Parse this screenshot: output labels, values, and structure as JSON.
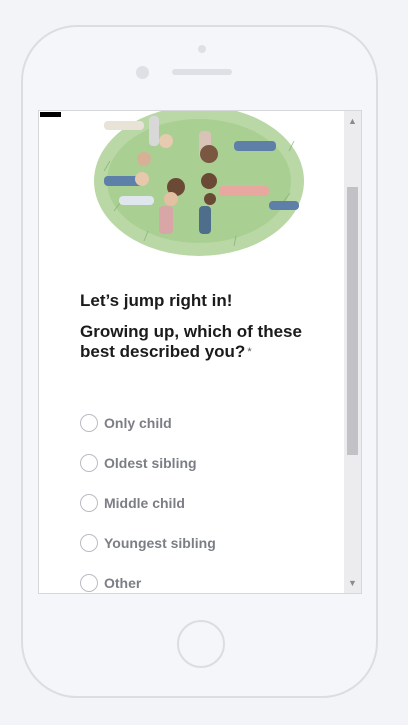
{
  "survey": {
    "intro": "Let’s jump right in!",
    "question": "Growing up, which of these best described you?",
    "required_mark": "*",
    "options": [
      {
        "label": "Only child"
      },
      {
        "label": "Oldest sibling"
      },
      {
        "label": "Middle child"
      },
      {
        "label": "Youngest sibling"
      },
      {
        "label": "Other"
      }
    ]
  },
  "icons": {
    "scroll_up": "chevron-up-icon",
    "scroll_down": "chevron-down-icon"
  }
}
